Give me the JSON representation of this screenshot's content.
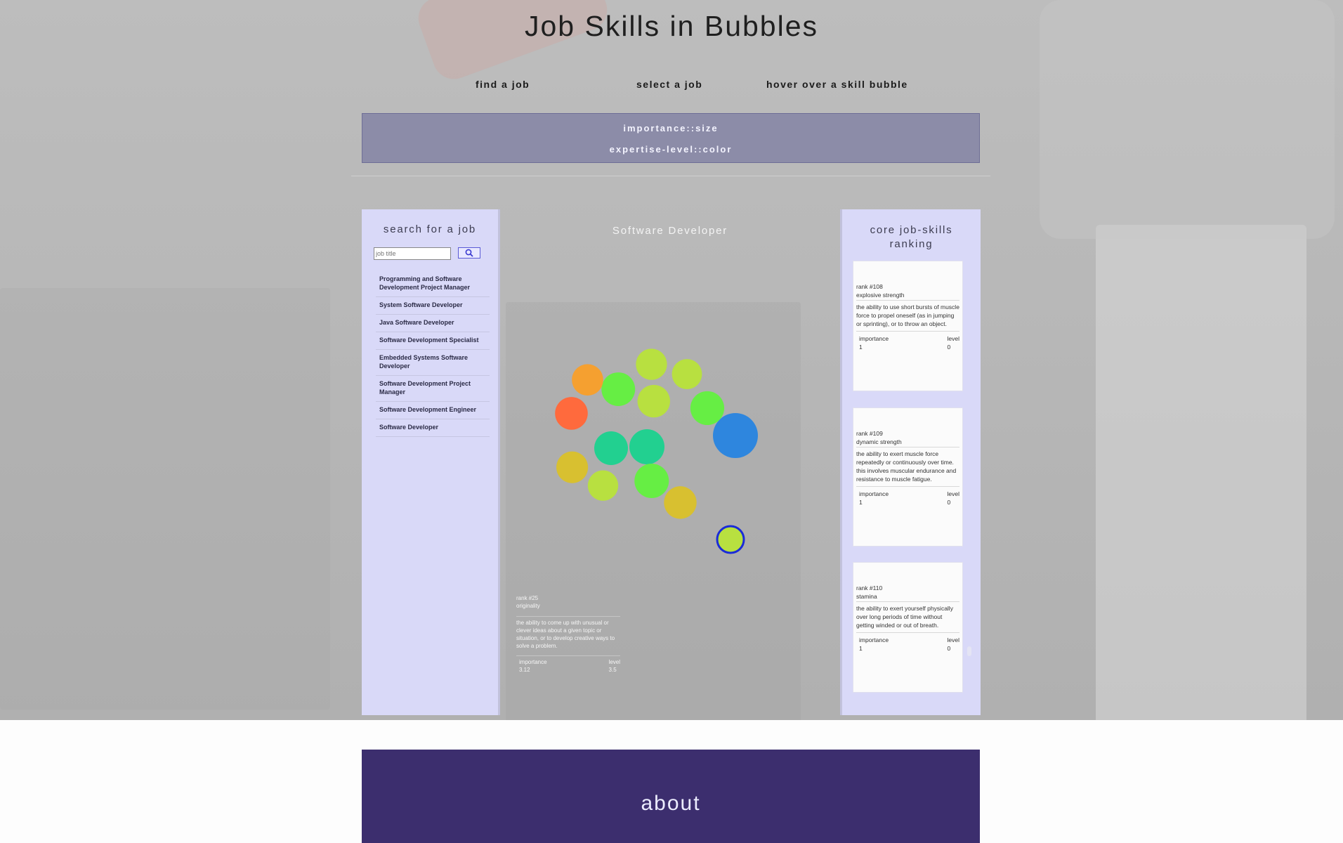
{
  "page": {
    "title": "Job Skills in Bubbles",
    "steps": [
      "find a job",
      "select a job",
      "hover over a skill bubble"
    ],
    "legend": {
      "line1": "importance::size",
      "line2": "expertise-level::color"
    }
  },
  "search": {
    "heading": "search for a job",
    "placeholder": "job title",
    "icon": "search-icon"
  },
  "jobs": [
    "Programming and Software Development Project Manager",
    "System Software Developer",
    "Java Software Developer",
    "Software Development Specialist",
    "Embedded Systems Software Developer",
    "Software Development Project Manager",
    "Software Development Engineer",
    "Software Developer"
  ],
  "selected_job": "Software Developer",
  "tooltip": {
    "rank": "rank #25",
    "name": "originality",
    "description": "the ability to come up with unusual or clever ideas about a given topic or situation, or to develop creative ways to solve a problem.",
    "importance_label": "importance",
    "importance_value": "3.12",
    "level_label": "level",
    "level_value": "3.5"
  },
  "ranking": {
    "heading": "core job-skills ranking",
    "cards": [
      {
        "rank": "rank #108",
        "name": "explosive strength",
        "description": "the ability to use short bursts of muscle force to propel oneself (as in jumping or sprinting), or to throw an object.",
        "importance_label": "importance",
        "importance_value": "1",
        "level_label": "level",
        "level_value": "0"
      },
      {
        "rank": "rank #109",
        "name": "dynamic strength",
        "description": "the ability to exert muscle force repeatedly or continuously over time. this involves muscular endurance and resistance to muscle fatigue.",
        "importance_label": "importance",
        "importance_value": "1",
        "level_label": "level",
        "level_value": "0"
      },
      {
        "rank": "rank #110",
        "name": "stamina",
        "description": "the ability to exert yourself physically over long periods of time without getting winded or out of breath.",
        "importance_label": "importance",
        "importance_value": "1",
        "level_label": "level",
        "level_value": "0"
      }
    ]
  },
  "about": {
    "label": "about"
  },
  "colors": {
    "legend_bg": "#8c8ca8",
    "panel_bg": "#d9d9f8",
    "about_bg": "#3c2e6e",
    "highlight_ring": "#1a2bd8",
    "bubble_palette": [
      "#ff6a3d",
      "#f5a030",
      "#d8c030",
      "#b8e040",
      "#66ee44",
      "#3cdc6a",
      "#22d090",
      "#2e86de",
      "#ff3e6c",
      "#d63ab0"
    ]
  }
}
